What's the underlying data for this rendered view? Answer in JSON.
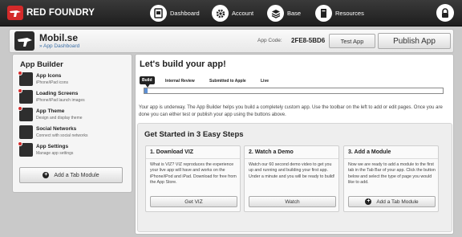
{
  "brand": {
    "name": "RED FOUNDRY"
  },
  "nav": [
    {
      "label": "Dashboard",
      "icon": "dashboard-icon"
    },
    {
      "label": "Account",
      "icon": "gear-icon"
    },
    {
      "label": "Base",
      "icon": "layers-icon"
    },
    {
      "label": "Resources",
      "icon": "book-icon"
    }
  ],
  "app": {
    "name": "Mobil.se",
    "dashboard_link": "» App Dashboard",
    "code_label": "App Code:",
    "code": "2FE8-5BD6",
    "test_label": "Test App",
    "publish_label": "Publish App"
  },
  "sidebar": {
    "title": "App Builder",
    "items": [
      {
        "name": "App Icons",
        "sub": "iPhone/iPad icons",
        "alert": true
      },
      {
        "name": "Loading Screens",
        "sub": "iPhone/iPad launch images",
        "alert": true
      },
      {
        "name": "App Theme",
        "sub": "Design and display theme",
        "alert": true
      },
      {
        "name": "Social Networks",
        "sub": "Connect with social networks",
        "alert": false
      },
      {
        "name": "App Settings",
        "sub": "Manage app settings",
        "alert": true
      }
    ],
    "add_tab_label": "Add a Tab Module"
  },
  "main": {
    "title": "Let's build your app!",
    "steps": [
      "Build",
      "Internal Review",
      "Submitted to Apple",
      "Live"
    ],
    "progress": 0.01,
    "intro": "Your app is underway. The App Builder helps you build a completely custom app. Use the toolbar on the left to add or edit pages. Once you are done you can either test or publish your app using the buttons above.",
    "get_started_title": "Get Started in 3 Easy Steps",
    "columns": [
      {
        "title": "1. Download VIZ",
        "text": "What is VIZ? VIZ reproduces the experience your live app will have and works on the iPhone/iPod and iPad. Download for free from the App Store.",
        "button": "Get VIZ"
      },
      {
        "title": "2. Watch a Demo",
        "text": "Watch our 60 second demo video to get you up and running and building your first app. Under a minute and you will be ready to build!",
        "button": "Watch"
      },
      {
        "title": "3. Add a Module",
        "text": "Now we are ready to add a module to the first tab in the Tab Bar of your app. Click the button below and select the type of page you would like to add.",
        "button": "Add a Tab Module"
      }
    ]
  }
}
